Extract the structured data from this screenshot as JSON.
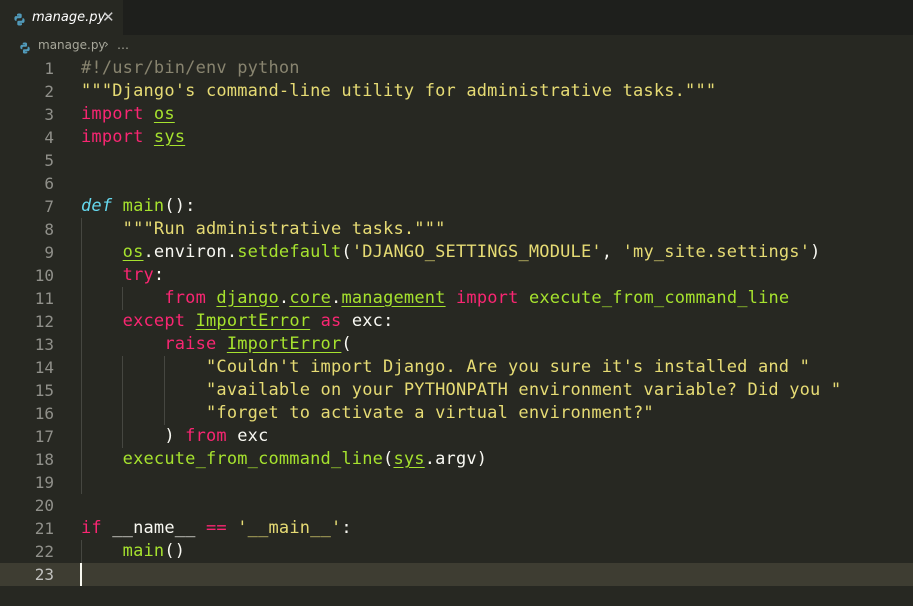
{
  "tab": {
    "filename": "manage.py",
    "close_glyph": "✕",
    "icon": "python-icon"
  },
  "breadcrumb": {
    "file": "manage.py",
    "separator": "›",
    "more": "…"
  },
  "colors": {
    "background": "#272822",
    "comment": "#88846f",
    "string": "#e6db74",
    "keyword": "#f92672",
    "storage": "#66d9ef",
    "function": "#a6e22e",
    "text": "#f8f8f2"
  },
  "editor": {
    "current_line": 23,
    "lines": [
      {
        "n": "1",
        "tokens": [
          [
            "cm",
            "#!/usr/bin/env python"
          ]
        ]
      },
      {
        "n": "2",
        "tokens": [
          [
            "str",
            "\"\"\"Django's command-line utility for administrative tasks.\"\"\""
          ]
        ]
      },
      {
        "n": "3",
        "tokens": [
          [
            "kw",
            "import"
          ],
          [
            "pl",
            " "
          ],
          [
            "mod",
            "os"
          ]
        ]
      },
      {
        "n": "4",
        "tokens": [
          [
            "kw",
            "import"
          ],
          [
            "pl",
            " "
          ],
          [
            "mod",
            "sys"
          ]
        ]
      },
      {
        "n": "5",
        "tokens": []
      },
      {
        "n": "6",
        "tokens": []
      },
      {
        "n": "7",
        "tokens": [
          [
            "def",
            "def"
          ],
          [
            "pl",
            " "
          ],
          [
            "fn",
            "main"
          ],
          [
            "pl",
            "():"
          ]
        ]
      },
      {
        "n": "8",
        "tokens": [
          [
            "pl",
            "    "
          ],
          [
            "str",
            "\"\"\"Run administrative tasks.\"\"\""
          ]
        ]
      },
      {
        "n": "9",
        "tokens": [
          [
            "pl",
            "    "
          ],
          [
            "mod",
            "os"
          ],
          [
            "pl",
            ".environ."
          ],
          [
            "fn",
            "setdefault"
          ],
          [
            "pl",
            "("
          ],
          [
            "str",
            "'DJANGO_SETTINGS_MODULE'"
          ],
          [
            "pl",
            ", "
          ],
          [
            "str",
            "'my_site.settings'"
          ],
          [
            "pl",
            ")"
          ]
        ]
      },
      {
        "n": "10",
        "tokens": [
          [
            "pl",
            "    "
          ],
          [
            "kw",
            "try"
          ],
          [
            "pl",
            ":"
          ]
        ]
      },
      {
        "n": "11",
        "tokens": [
          [
            "pl",
            "        "
          ],
          [
            "kw",
            "from"
          ],
          [
            "pl",
            " "
          ],
          [
            "mod",
            "django"
          ],
          [
            "pl",
            "."
          ],
          [
            "mod",
            "core"
          ],
          [
            "pl",
            "."
          ],
          [
            "mod",
            "management"
          ],
          [
            "pl",
            " "
          ],
          [
            "kw",
            "import"
          ],
          [
            "pl",
            " "
          ],
          [
            "fn",
            "execute_from_command_line"
          ]
        ]
      },
      {
        "n": "12",
        "tokens": [
          [
            "pl",
            "    "
          ],
          [
            "kw",
            "except"
          ],
          [
            "pl",
            " "
          ],
          [
            "mod",
            "ImportError"
          ],
          [
            "pl",
            " "
          ],
          [
            "kw",
            "as"
          ],
          [
            "pl",
            " exc:"
          ]
        ]
      },
      {
        "n": "13",
        "tokens": [
          [
            "pl",
            "        "
          ],
          [
            "kw",
            "raise"
          ],
          [
            "pl",
            " "
          ],
          [
            "mod",
            "ImportError"
          ],
          [
            "pl",
            "("
          ]
        ]
      },
      {
        "n": "14",
        "tokens": [
          [
            "pl",
            "            "
          ],
          [
            "str",
            "\"Couldn't import Django. Are you sure it's installed and \""
          ]
        ]
      },
      {
        "n": "15",
        "tokens": [
          [
            "pl",
            "            "
          ],
          [
            "str",
            "\"available on your PYTHONPATH environment variable? Did you \""
          ]
        ]
      },
      {
        "n": "16",
        "tokens": [
          [
            "pl",
            "            "
          ],
          [
            "str",
            "\"forget to activate a virtual environment?\""
          ]
        ]
      },
      {
        "n": "17",
        "tokens": [
          [
            "pl",
            "        ) "
          ],
          [
            "kw",
            "from"
          ],
          [
            "pl",
            " exc"
          ]
        ]
      },
      {
        "n": "18",
        "tokens": [
          [
            "pl",
            "    "
          ],
          [
            "fn",
            "execute_from_command_line"
          ],
          [
            "pl",
            "("
          ],
          [
            "mod",
            "sys"
          ],
          [
            "pl",
            ".argv)"
          ]
        ]
      },
      {
        "n": "19",
        "tokens": []
      },
      {
        "n": "20",
        "tokens": []
      },
      {
        "n": "21",
        "tokens": [
          [
            "kw",
            "if"
          ],
          [
            "pl",
            " __name__ "
          ],
          [
            "kw",
            "=="
          ],
          [
            "pl",
            " "
          ],
          [
            "str",
            "'__main__'"
          ],
          [
            "pl",
            ":"
          ]
        ]
      },
      {
        "n": "22",
        "tokens": [
          [
            "pl",
            "    "
          ],
          [
            "fn",
            "main"
          ],
          [
            "pl",
            "()"
          ]
        ]
      },
      {
        "n": "23",
        "tokens": []
      }
    ]
  }
}
